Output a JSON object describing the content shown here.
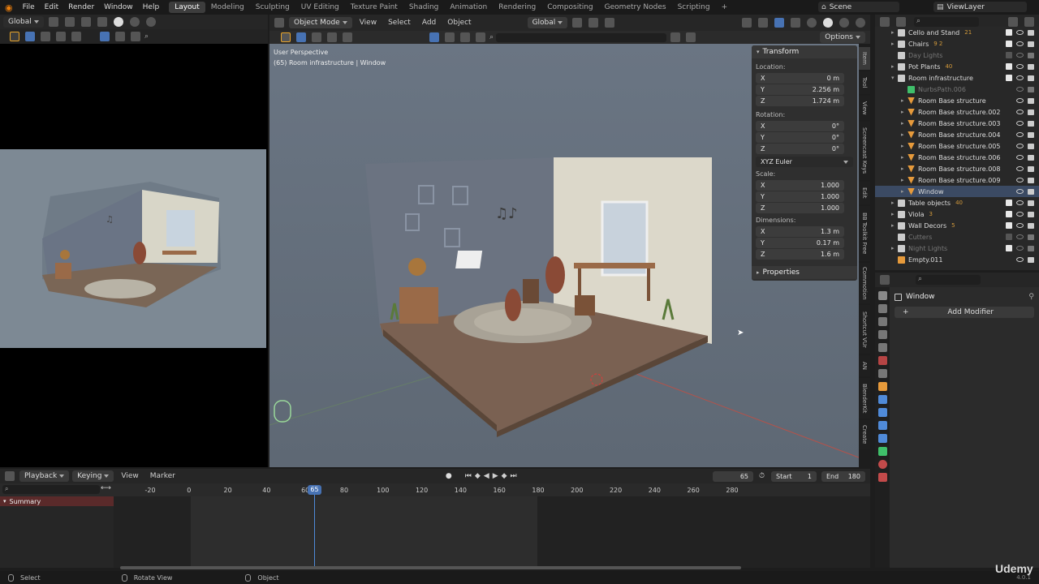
{
  "menubar": {
    "items": [
      "File",
      "Edit",
      "Render",
      "Window",
      "Help"
    ],
    "workspaces": [
      "Layout",
      "Modeling",
      "Sculpting",
      "UV Editing",
      "Texture Paint",
      "Shading",
      "Animation",
      "Rendering",
      "Compositing",
      "Geometry Nodes",
      "Scripting"
    ],
    "active_workspace": "Layout",
    "add_workspace": "+",
    "scene": "Scene",
    "view_layer": "ViewLayer"
  },
  "left_editor": {
    "orientation": "Global"
  },
  "viewport": {
    "mode": "Object Mode",
    "menus": [
      "View",
      "Select",
      "Add",
      "Object"
    ],
    "orientation": "Global",
    "options": "Options",
    "perspective": "User Perspective",
    "active_object": "(65) Room infrastructure | Window"
  },
  "npanel": {
    "transform_title": "Transform",
    "location_label": "Location:",
    "location": [
      {
        "axis": "X",
        "value": "0 m"
      },
      {
        "axis": "Y",
        "value": "2.256 m"
      },
      {
        "axis": "Z",
        "value": "1.724 m"
      }
    ],
    "rotation_label": "Rotation:",
    "rotation": [
      {
        "axis": "X",
        "value": "0°"
      },
      {
        "axis": "Y",
        "value": "0°"
      },
      {
        "axis": "Z",
        "value": "0°"
      }
    ],
    "rotation_mode": "XYZ Euler",
    "scale_label": "Scale:",
    "scale": [
      {
        "axis": "X",
        "value": "1.000"
      },
      {
        "axis": "Y",
        "value": "1.000"
      },
      {
        "axis": "Z",
        "value": "1.000"
      }
    ],
    "dimensions_label": "Dimensions:",
    "dimensions": [
      {
        "axis": "X",
        "value": "1.3 m"
      },
      {
        "axis": "Y",
        "value": "0.17 m"
      },
      {
        "axis": "Z",
        "value": "1.6 m"
      }
    ],
    "properties_title": "Properties",
    "tabs": [
      "Item",
      "Tool",
      "View",
      "Screencast Keys",
      "Edit",
      "BB Toolkit Free",
      "Commotion",
      "Shortcut VUr",
      "AN",
      "BlenderKit",
      "Create"
    ]
  },
  "outliner": {
    "rows": [
      {
        "name": "Cello and Stand",
        "indent": 1,
        "expand": "▸",
        "icon": "collection",
        "badge": "21",
        "muted": false,
        "check": true
      },
      {
        "name": "Chairs",
        "indent": 1,
        "expand": "▸",
        "icon": "collection",
        "badge": "9 2",
        "muted": false,
        "check": true
      },
      {
        "name": "Day Lights",
        "indent": 1,
        "expand": "",
        "icon": "collection",
        "badge": "",
        "muted": true,
        "check": false
      },
      {
        "name": "Pot Plants",
        "indent": 1,
        "expand": "▸",
        "icon": "collection",
        "badge": "40",
        "muted": false,
        "check": true
      },
      {
        "name": "Room infrastructure",
        "indent": 1,
        "expand": "▾",
        "icon": "collection",
        "badge": "",
        "muted": false,
        "check": true
      },
      {
        "name": "NurbsPath.006",
        "indent": 2,
        "expand": "",
        "icon": "curve",
        "badge": "",
        "muted": true,
        "check": null
      },
      {
        "name": "Room Base structure",
        "indent": 2,
        "expand": "▸",
        "icon": "mesh",
        "badge": "",
        "muted": false,
        "check": null
      },
      {
        "name": "Room Base structure.002",
        "indent": 2,
        "expand": "▸",
        "icon": "mesh",
        "badge": "",
        "muted": false,
        "check": null
      },
      {
        "name": "Room Base structure.003",
        "indent": 2,
        "expand": "▸",
        "icon": "mesh",
        "badge": "",
        "muted": false,
        "check": null
      },
      {
        "name": "Room Base structure.004",
        "indent": 2,
        "expand": "▸",
        "icon": "mesh",
        "badge": "",
        "muted": false,
        "check": null
      },
      {
        "name": "Room Base structure.005",
        "indent": 2,
        "expand": "▸",
        "icon": "mesh",
        "badge": "",
        "muted": false,
        "check": null
      },
      {
        "name": "Room Base structure.006",
        "indent": 2,
        "expand": "▸",
        "icon": "mesh",
        "badge": "",
        "muted": false,
        "check": null
      },
      {
        "name": "Room Base structure.008",
        "indent": 2,
        "expand": "▸",
        "icon": "mesh",
        "badge": "",
        "muted": false,
        "check": null
      },
      {
        "name": "Room Base structure.009",
        "indent": 2,
        "expand": "▸",
        "icon": "mesh",
        "badge": "",
        "muted": false,
        "check": null
      },
      {
        "name": "Window",
        "indent": 2,
        "expand": "▸",
        "icon": "mesh",
        "badge": "",
        "muted": false,
        "check": null,
        "active": true
      },
      {
        "name": "Table objects",
        "indent": 1,
        "expand": "▸",
        "icon": "collection",
        "badge": "40",
        "muted": false,
        "check": true
      },
      {
        "name": "Viola",
        "indent": 1,
        "expand": "▸",
        "icon": "collection",
        "badge": "3",
        "muted": false,
        "check": true
      },
      {
        "name": "Wall Decors",
        "indent": 1,
        "expand": "▸",
        "icon": "collection",
        "badge": "5",
        "muted": false,
        "check": true
      },
      {
        "name": "Cutters",
        "indent": 1,
        "expand": "",
        "icon": "collection",
        "badge": "",
        "muted": true,
        "check": false
      },
      {
        "name": "Night Lights",
        "indent": 1,
        "expand": "▸",
        "icon": "collection",
        "badge": "",
        "muted": true,
        "check": true
      },
      {
        "name": "Empty.011",
        "indent": 1,
        "expand": "",
        "icon": "empty",
        "badge": "",
        "muted": false,
        "check": null
      }
    ]
  },
  "properties": {
    "object_name": "Window",
    "add_modifier": "Add Modifier"
  },
  "timeline": {
    "menus": [
      "Playback",
      "Keying",
      "View",
      "Marker"
    ],
    "current_frame": "65",
    "start_label": "Start",
    "start": "1",
    "end_label": "End",
    "end": "180",
    "ticks": [
      "-20",
      "0",
      "20",
      "40",
      "60",
      "80",
      "100",
      "120",
      "140",
      "160",
      "180",
      "200",
      "220",
      "240",
      "260",
      "280"
    ],
    "summary": "Summary",
    "frame_indicator": "65"
  },
  "statusbar": {
    "items": [
      "Select",
      "Rotate View",
      "Object"
    ],
    "version": "4.0.1",
    "watermark": "Udemy"
  },
  "colors": {
    "viewport_bg": "#6e7a86",
    "accent_blue": "#4772b3",
    "active_orange": "#e69a3b",
    "mesh_green": "#3fbf6a"
  }
}
